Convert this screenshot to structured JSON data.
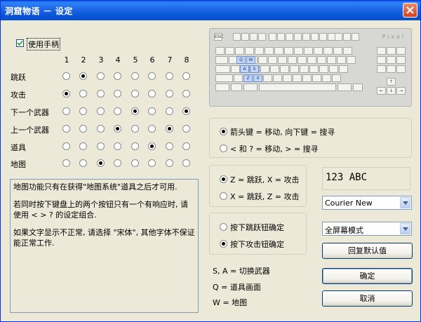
{
  "window": {
    "title": "洞窟物语 － 设定"
  },
  "use_gamepad": {
    "label": "使用手柄",
    "checked": true
  },
  "gamepad": {
    "columns": [
      "1",
      "2",
      "3",
      "4",
      "5",
      "6",
      "7",
      "8"
    ],
    "rows": [
      {
        "label": "跳跃",
        "selected": 2
      },
      {
        "label": "攻击",
        "selected": 1
      },
      {
        "label": "下一个武器",
        "selected": 5
      },
      {
        "label": "上一个武器",
        "selected": 4
      },
      {
        "label": "道具",
        "selected": 6
      },
      {
        "label": "地图",
        "selected": 3
      }
    ],
    "row_extra_selected": {
      "下一个武器": 8,
      "上一个武器": 7
    }
  },
  "info_text": [
    "地图功能只有在获得\"地图系统\"道具之后才可用.",
    "若同时按下键盘上的两个按钮只有一个有响应时, 请使用 < > ? 的设定组合.",
    "如果文字显示不正常, 请选择 \"宋体\", 其他字体不保证能正常工作."
  ],
  "keyboard": {
    "esc_label": "ESC",
    "brand": "Pixel",
    "highlight_keys": [
      "Q",
      "W",
      "A",
      "S",
      "Z",
      "X"
    ]
  },
  "move_options": {
    "option1": "箭头键 = 移动, 向下键 = 搜寻",
    "option2": "< 和 ? = 移动, > = 搜寻",
    "selected": 1
  },
  "jump_attack_options": {
    "option1": "Z = 跳跃, X = 攻击",
    "option2": "X = 跳跃, Z = 攻击",
    "selected": 1
  },
  "confirm_options": {
    "option1": "按下跳跃钮确定",
    "option2": "按下攻击钮确定",
    "selected": 2
  },
  "hints": {
    "switch_weapon": "S, A = 切换武器",
    "item_screen": "Q = 道具画面",
    "map": "W = 地图"
  },
  "font_preview": "123 ABC",
  "font_select": {
    "value": "Courier New"
  },
  "display_select": {
    "value": "全屏幕模式"
  },
  "buttons": {
    "restore_defaults": "回复默认值",
    "ok": "确定",
    "cancel": "取消"
  }
}
